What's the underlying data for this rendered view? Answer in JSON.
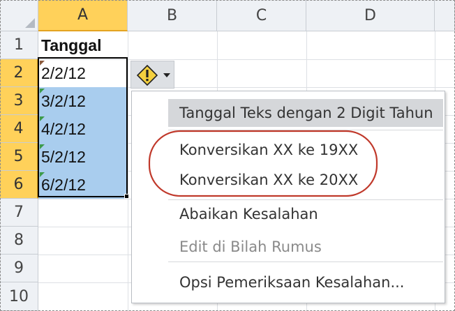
{
  "columns": [
    {
      "label": "A",
      "selected": true
    },
    {
      "label": "B",
      "selected": false
    },
    {
      "label": "C",
      "selected": false
    },
    {
      "label": "D",
      "selected": false
    }
  ],
  "rows": [
    {
      "label": "1",
      "selected": false
    },
    {
      "label": "2",
      "selected": true
    },
    {
      "label": "3",
      "selected": true
    },
    {
      "label": "4",
      "selected": true
    },
    {
      "label": "5",
      "selected": true
    },
    {
      "label": "6",
      "selected": true
    },
    {
      "label": "7",
      "selected": false
    },
    {
      "label": "8",
      "selected": false
    },
    {
      "label": "9",
      "selected": false
    },
    {
      "label": "10",
      "selected": false
    }
  ],
  "cells_a": [
    "Tanggal",
    "2/2/12",
    "3/2/12",
    "4/2/12",
    "5/2/12",
    "6/2/12"
  ],
  "smart_tag": {
    "icon": "warning-diamond-icon",
    "dropdown_icon": "caret-down-icon"
  },
  "menu": {
    "items": [
      {
        "label": "Tanggal Teks dengan 2 Digit Tahun",
        "state": "highlighted"
      },
      {
        "label": "Konversikan XX ke 19XX",
        "state": "enabled"
      },
      {
        "label": "Konversikan XX ke 20XX",
        "state": "enabled"
      },
      {
        "label": "Abaikan Kesalahan",
        "state": "enabled"
      },
      {
        "label": "Edit di Bilah Rumus",
        "state": "disabled"
      },
      {
        "label": "Opsi Pemeriksaan Kesalahan...",
        "state": "enabled"
      }
    ]
  },
  "colors": {
    "selection_fill": "#a9cdee",
    "header_selected": "#ffd15a",
    "annotation_circle": "#c0392b",
    "error_triangle": "#3c9a4a",
    "warning_diamond": "#f4d03f"
  }
}
